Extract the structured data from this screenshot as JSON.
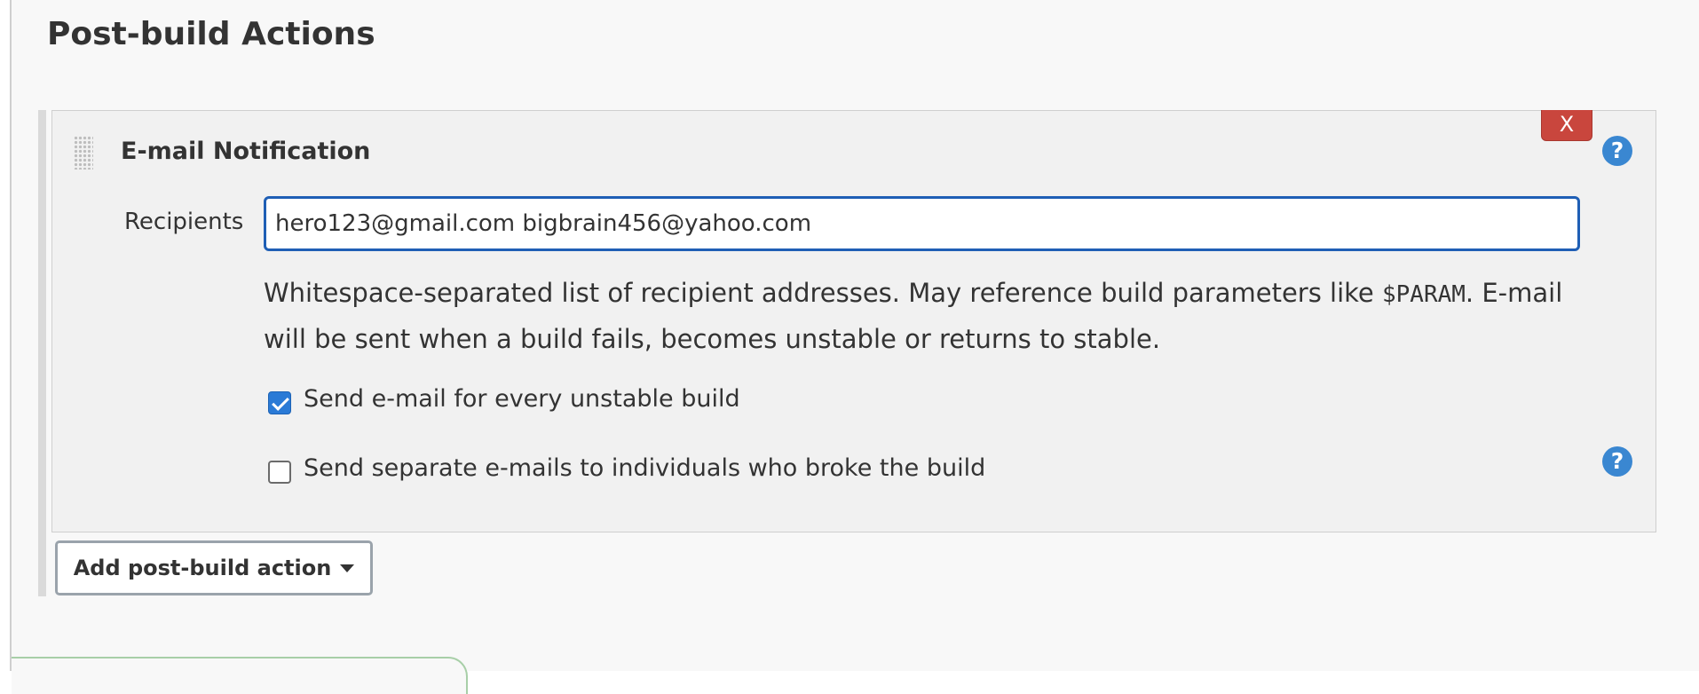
{
  "section": {
    "title": "Post-build Actions"
  },
  "email_notification": {
    "title": "E-mail Notification",
    "delete_label": "X",
    "help_label": "?",
    "recipients": {
      "label": "Recipients",
      "value": "hero123@gmail.com bigbrain456@yahoo.com"
    },
    "description": {
      "before_code": "Whitespace-separated list of recipient addresses. May reference build parameters like ",
      "code": "$PARAM",
      "after_code": ". E-mail will be sent when a build fails, becomes unstable or returns to stable."
    },
    "options": [
      {
        "label": "Send e-mail for every unstable build",
        "checked": true
      },
      {
        "label": "Send separate e-mails to individuals who broke the build",
        "checked": false
      }
    ],
    "option_help_label": "?"
  },
  "add_action": {
    "label": "Add post-build action"
  },
  "colors": {
    "delete_button": "#c9463d",
    "help_icon": "#3a87d1",
    "input_focus_border": "#1f5fb5",
    "checkbox_checked": "#2a7ad6"
  },
  "icons": {
    "drag": "drag-handle-icon",
    "help": "help-icon",
    "caret": "caret-down-icon"
  }
}
